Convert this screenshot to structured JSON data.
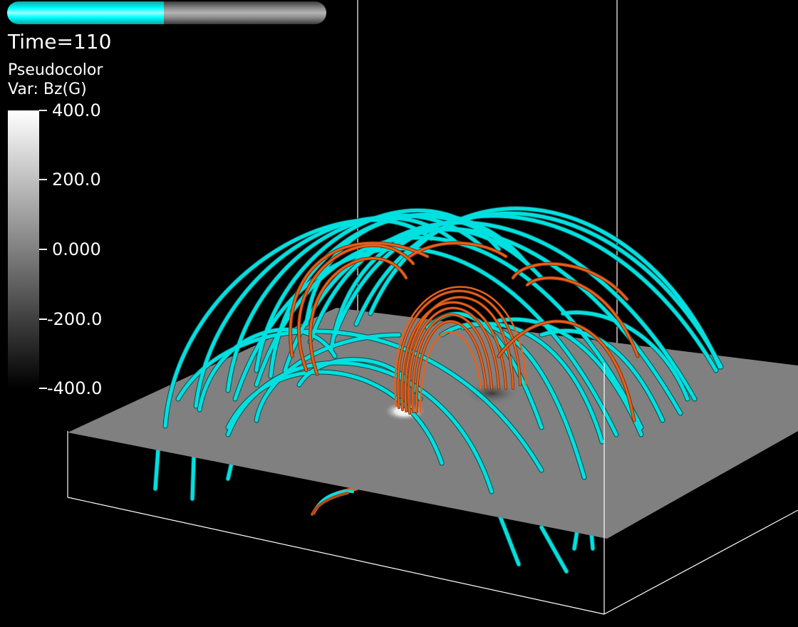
{
  "time_slider": {
    "progress": 0.49
  },
  "time_label": "Time=110",
  "legend": {
    "plot_name": "Pseudocolor",
    "var_name": "Var: Bz(G)",
    "ticks": [
      "400.0",
      "200.0",
      "0.000",
      "-200.0",
      "-400.0"
    ],
    "range": [
      -400,
      400
    ],
    "colormap": [
      "#000000",
      "#ffffff"
    ]
  },
  "scene": {
    "background": "#000000",
    "plane_color": "#808080",
    "field_line_colors": [
      "#00e0e0",
      "#e8601a"
    ]
  }
}
